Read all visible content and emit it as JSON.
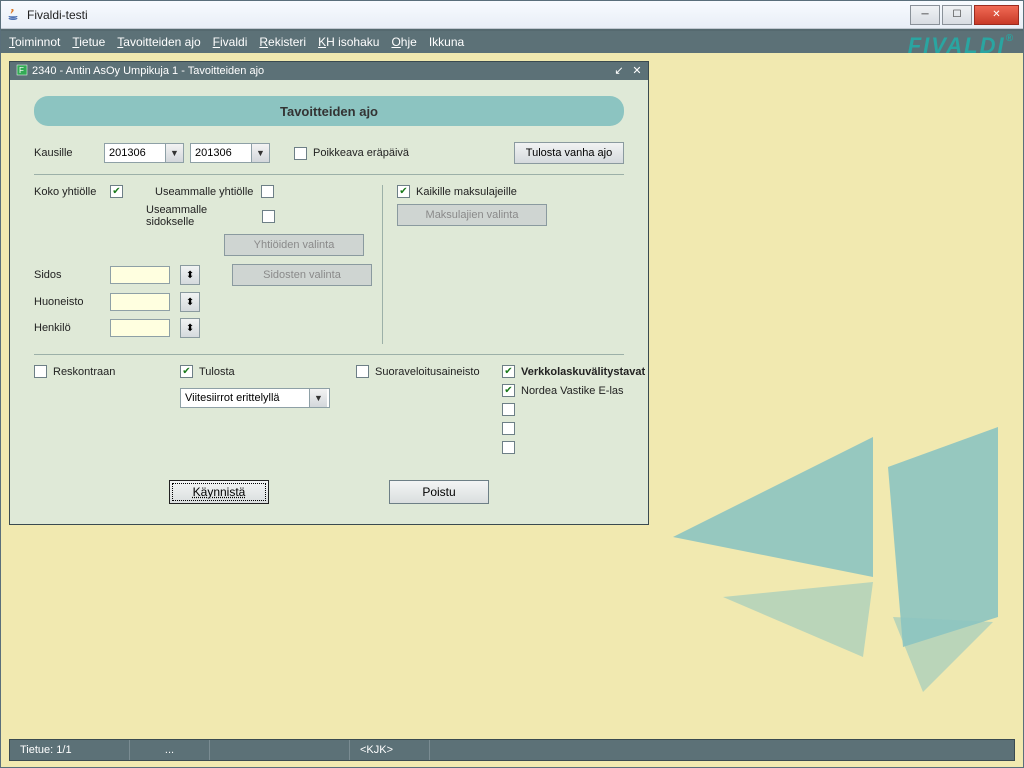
{
  "window": {
    "title": "Fivaldi-testi"
  },
  "brand": "FIVALDI",
  "menu": {
    "toiminnot": "Toiminnot",
    "tietue": "Tietue",
    "tavoitteiden_ajo": "Tavoitteiden ajo",
    "fivaldi": "Fivaldi",
    "rekisteri": "Rekisteri",
    "kh_isohaku": "KH isohaku",
    "ohje": "Ohje",
    "ikkuna": "Ikkuna"
  },
  "inner": {
    "title": "2340 - Antin AsOy Umpikuja 1 - Tavoitteiden ajo",
    "heading": "Tavoitteiden ajo",
    "kausille_label": "Kausille",
    "kausi_from": "201306",
    "kausi_to": "201306",
    "poikkeava_label": "Poikkeava eräpäivä",
    "tulosta_vanha": "Tulosta vanha ajo",
    "koko_yhtiolle": "Koko yhtiölle",
    "useammalle_yhtiolle": "Useammalle yhtiölle",
    "useammalle_sidokselle": "Useammalle sidokselle",
    "yhtioiden_valinta": "Yhtiöiden valinta",
    "sidosten_valinta": "Sidosten valinta",
    "kaikille_maksulajeille": "Kaikille maksulajeille",
    "maksulajien_valinta": "Maksulajien valinta",
    "sidos": "Sidos",
    "huoneisto": "Huoneisto",
    "henkilo": "Henkilö",
    "reskontraan": "Reskontraan",
    "tulosta": "Tulosta",
    "suoraveloitus": "Suoraveloitusaineisto",
    "viitesiirrot": "Viitesiirrot erittelyllä",
    "verkkolasku": "Verkkolaskuvälitystavat",
    "nordea": "Nordea Vastike E-las",
    "kaynnista": "Käynnistä",
    "poistu": "Poistu"
  },
  "status": {
    "tietue": "Tietue: 1/1",
    "dots": "...",
    "kjk": "<KJK>"
  }
}
